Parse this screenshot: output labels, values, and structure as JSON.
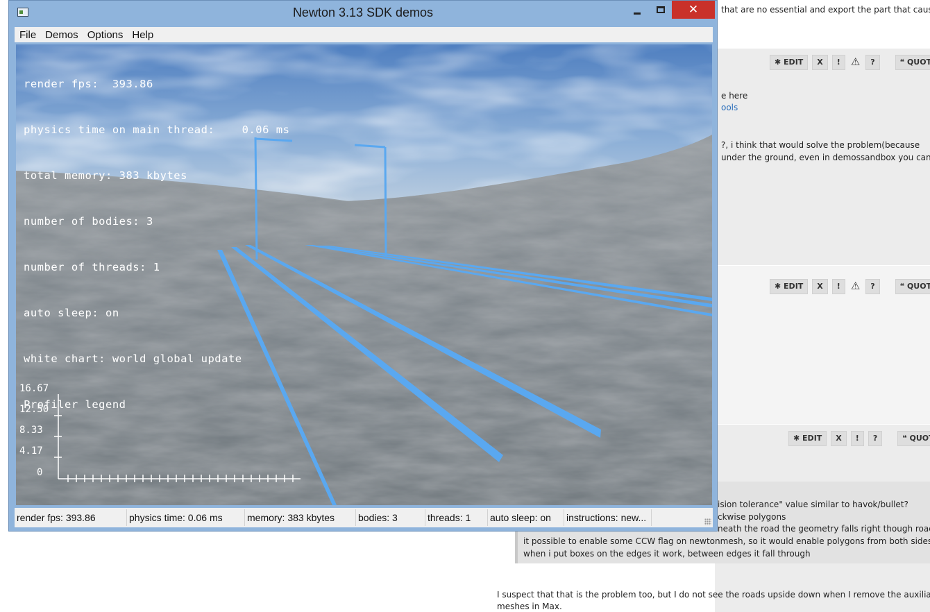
{
  "window": {
    "title": "Newton 3.13 SDK demos",
    "controls": {
      "minimize": "minimize",
      "maximize": "maximize",
      "close": "✕"
    }
  },
  "menu": [
    "File",
    "Demos",
    "Options",
    "Help"
  ],
  "hud": {
    "lines": [
      "render fps:  393.86",
      "physics time on main thread:    0.06 ms",
      "total memory: 383 kbytes",
      "number of bodies: 3",
      "number of threads: 1",
      "auto sleep: on",
      "white chart: world global update",
      "Profiler legend"
    ]
  },
  "profiler_chart": {
    "y_ticks": [
      "16.67",
      "12.50",
      "8.33",
      "4.17",
      "0"
    ]
  },
  "statusbar": [
    "render fps:  393.86",
    "physics time: 0.06 ms",
    "memory: 383 kbytes",
    "bodies: 3",
    "threads: 1",
    "auto sleep: on",
    "instructions: new..."
  ],
  "forum": {
    "top_text": "that are no essential and export the part that cause",
    "buttons": {
      "edit": "EDIT",
      "delete": "X",
      "report": "!",
      "warn": "⚠",
      "info": "?",
      "quote": "QUOTE"
    },
    "post1": {
      "line1": "e here",
      "link": "ools",
      "line3": "?, i think that would solve the problem(because",
      "line4": "under the ground, even in demossandbox you can"
    },
    "quote": {
      "lines": [
        "ision tolerance\" value similar to havok/bullet?",
        "ckwise polygons",
        "neath the road the geometry falls right though road, is",
        "it possible to enable some CCW flag on newtonmesh, so it would enable polygons from both sides?",
        "when i put boxes on the edges it work, between edges it fall through"
      ]
    },
    "reply": {
      "line1": "I suspect that that is the problem too, but I do not see the roads upside down when I remove the auxiliary AI",
      "line2": "meshes in Max."
    }
  },
  "colors": {
    "road_lines": "#5aa8f0",
    "close_button": "#c9312a",
    "window_frame": "#8fb4dc",
    "hud_text": "#ffffff"
  }
}
